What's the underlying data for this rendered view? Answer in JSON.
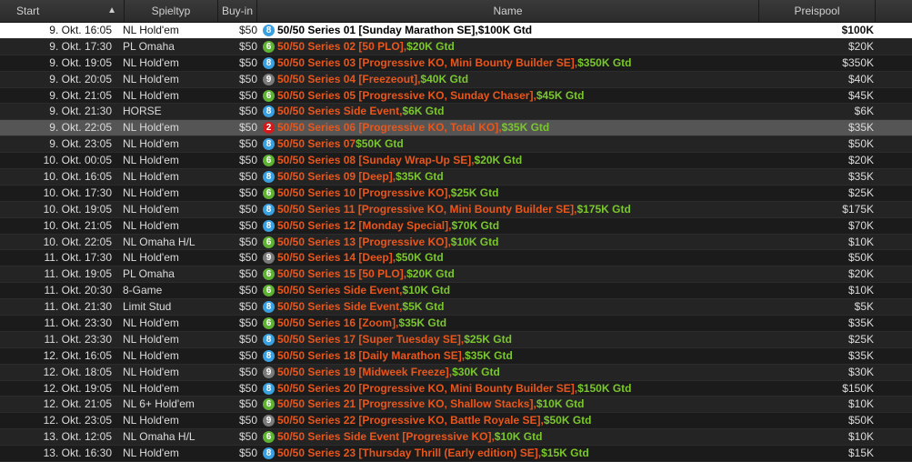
{
  "colors": {
    "name_orange": "#e8561c",
    "gtd_green": "#7ac72d",
    "badge_8": "#3aa0e0",
    "badge_6": "#5fb233",
    "badge_9": "#7a7a7a",
    "badge_2": "#d21a1a"
  },
  "header": {
    "start": "Start",
    "sort_icon": "▲",
    "type": "Spieltyp",
    "buyin": "Buy-in",
    "name": "Name",
    "prize": "Preispool"
  },
  "rows": [
    {
      "start": "9. Okt.  16:05",
      "type": "NL Hold'em",
      "buyin": "$50",
      "badge": "8",
      "name": "50/50 Series 01 [Sunday Marathon SE],",
      "gtd": " $100K Gtd",
      "prize": "$100K",
      "state": "selected"
    },
    {
      "start": "9. Okt.  17:30",
      "type": "PL Omaha",
      "buyin": "$50",
      "badge": "6",
      "name": "50/50 Series 02 [50 PLO],",
      "gtd": " $20K Gtd",
      "prize": "$20K",
      "state": ""
    },
    {
      "start": "9. Okt.  19:05",
      "type": "NL Hold'em",
      "buyin": "$50",
      "badge": "8",
      "name": "50/50 Series 03 [Progressive KO, Mini Bounty Builder SE],",
      "gtd": " $350K Gtd",
      "prize": "$350K",
      "state": ""
    },
    {
      "start": "9. Okt.  20:05",
      "type": "NL Hold'em",
      "buyin": "$50",
      "badge": "9",
      "name": "50/50 Series 04 [Freezeout],",
      "gtd": " $40K Gtd",
      "prize": "$40K",
      "state": ""
    },
    {
      "start": "9. Okt.  21:05",
      "type": "NL Hold'em",
      "buyin": "$50",
      "badge": "6",
      "name": "50/50 Series 05 [Progressive KO, Sunday Chaser],",
      "gtd": " $45K Gtd",
      "prize": "$45K",
      "state": ""
    },
    {
      "start": "9. Okt.  21:30",
      "type": "HORSE",
      "buyin": "$50",
      "badge": "8",
      "name": "50/50 Series Side Event,",
      "gtd": " $6K Gtd",
      "prize": "$6K",
      "state": ""
    },
    {
      "start": "9. Okt.  22:05",
      "type": "NL Hold'em",
      "buyin": "$50",
      "badge": "2",
      "name": "50/50 Series 06 [Progressive KO, Total KO],",
      "gtd": " $35K Gtd",
      "prize": "$35K",
      "state": "hover"
    },
    {
      "start": "9. Okt.  23:05",
      "type": "NL Hold'em",
      "buyin": "$50",
      "badge": "8",
      "name": "50/50 Series 07",
      "gtd": " $50K Gtd",
      "prize": "$50K",
      "state": ""
    },
    {
      "start": "10. Okt.  00:05",
      "type": "NL Hold'em",
      "buyin": "$50",
      "badge": "6",
      "name": "50/50 Series 08 [Sunday Wrap-Up SE],",
      "gtd": " $20K Gtd",
      "prize": "$20K",
      "state": ""
    },
    {
      "start": "10. Okt.  16:05",
      "type": "NL Hold'em",
      "buyin": "$50",
      "badge": "8",
      "name": "50/50 Series 09 [Deep],",
      "gtd": " $35K Gtd",
      "prize": "$35K",
      "state": ""
    },
    {
      "start": "10. Okt.  17:30",
      "type": "NL Hold'em",
      "buyin": "$50",
      "badge": "6",
      "name": "50/50 Series 10 [Progressive KO],",
      "gtd": " $25K Gtd",
      "prize": "$25K",
      "state": ""
    },
    {
      "start": "10. Okt.  19:05",
      "type": "NL Hold'em",
      "buyin": "$50",
      "badge": "8",
      "name": "50/50 Series 11 [Progressive KO, Mini Bounty Builder SE],",
      "gtd": " $175K Gtd",
      "prize": "$175K",
      "state": ""
    },
    {
      "start": "10. Okt.  21:05",
      "type": "NL Hold'em",
      "buyin": "$50",
      "badge": "8",
      "name": "50/50 Series 12 [Monday Special],",
      "gtd": " $70K Gtd",
      "prize": "$70K",
      "state": ""
    },
    {
      "start": "10. Okt.  22:05",
      "type": "NL Omaha H/L",
      "buyin": "$50",
      "badge": "6",
      "name": "50/50 Series 13 [Progressive KO],",
      "gtd": " $10K Gtd",
      "prize": "$10K",
      "state": ""
    },
    {
      "start": "11. Okt.  17:30",
      "type": "NL Hold'em",
      "buyin": "$50",
      "badge": "9",
      "name": "50/50 Series 14 [Deep],",
      "gtd": " $50K Gtd",
      "prize": "$50K",
      "state": ""
    },
    {
      "start": "11. Okt.  19:05",
      "type": "PL Omaha",
      "buyin": "$50",
      "badge": "6",
      "name": "50/50 Series 15 [50 PLO],",
      "gtd": " $20K Gtd",
      "prize": "$20K",
      "state": ""
    },
    {
      "start": "11. Okt.  20:30",
      "type": "8-Game",
      "buyin": "$50",
      "badge": "6",
      "name": "50/50 Series Side Event,",
      "gtd": " $10K Gtd",
      "prize": "$10K",
      "state": ""
    },
    {
      "start": "11. Okt.  21:30",
      "type": "Limit Stud",
      "buyin": "$50",
      "badge": "8",
      "name": "50/50 Series Side Event,",
      "gtd": " $5K Gtd",
      "prize": "$5K",
      "state": ""
    },
    {
      "start": "11. Okt.  23:30",
      "type": "NL Hold'em",
      "buyin": "$50",
      "badge": "6",
      "name": "50/50 Series 16 [Zoom],",
      "gtd": " $35K Gtd",
      "prize": "$35K",
      "state": ""
    },
    {
      "start": "11. Okt.  23:30",
      "type": "NL Hold'em",
      "buyin": "$50",
      "badge": "8",
      "name": "50/50 Series 17 [Super Tuesday SE],",
      "gtd": " $25K Gtd",
      "prize": "$25K",
      "state": ""
    },
    {
      "start": "12. Okt.  16:05",
      "type": "NL Hold'em",
      "buyin": "$50",
      "badge": "8",
      "name": "50/50 Series 18 [Daily Marathon SE],",
      "gtd": " $35K Gtd",
      "prize": "$35K",
      "state": ""
    },
    {
      "start": "12. Okt.  18:05",
      "type": "NL Hold'em",
      "buyin": "$50",
      "badge": "9",
      "name": "50/50 Series 19 [Midweek Freeze],",
      "gtd": " $30K Gtd",
      "prize": "$30K",
      "state": ""
    },
    {
      "start": "12. Okt.  19:05",
      "type": "NL Hold'em",
      "buyin": "$50",
      "badge": "8",
      "name": "50/50 Series 20 [Progressive KO, Mini Bounty Builder SE],",
      "gtd": " $150K Gtd",
      "prize": "$150K",
      "state": ""
    },
    {
      "start": "12. Okt.  21:05",
      "type": "NL 6+ Hold'em",
      "buyin": "$50",
      "badge": "6",
      "name": "50/50 Series 21 [Progressive KO, Shallow Stacks],",
      "gtd": " $10K Gtd",
      "prize": "$10K",
      "state": ""
    },
    {
      "start": "12. Okt.  23:05",
      "type": "NL Hold'em",
      "buyin": "$50",
      "badge": "9",
      "name": "50/50 Series 22 [Progressive KO, Battle Royale SE],",
      "gtd": " $50K Gtd",
      "prize": "$50K",
      "state": ""
    },
    {
      "start": "13. Okt.  12:05",
      "type": "NL Omaha H/L",
      "buyin": "$50",
      "badge": "6",
      "name": "50/50 Series Side Event [Progressive KO],",
      "gtd": " $10K Gtd",
      "prize": "$10K",
      "state": ""
    },
    {
      "start": "13. Okt.  16:30",
      "type": "NL Hold'em",
      "buyin": "$50",
      "badge": "8",
      "name": "50/50 Series 23 [Thursday Thrill (Early edition) SE],",
      "gtd": " $15K Gtd",
      "prize": "$15K",
      "state": ""
    }
  ]
}
